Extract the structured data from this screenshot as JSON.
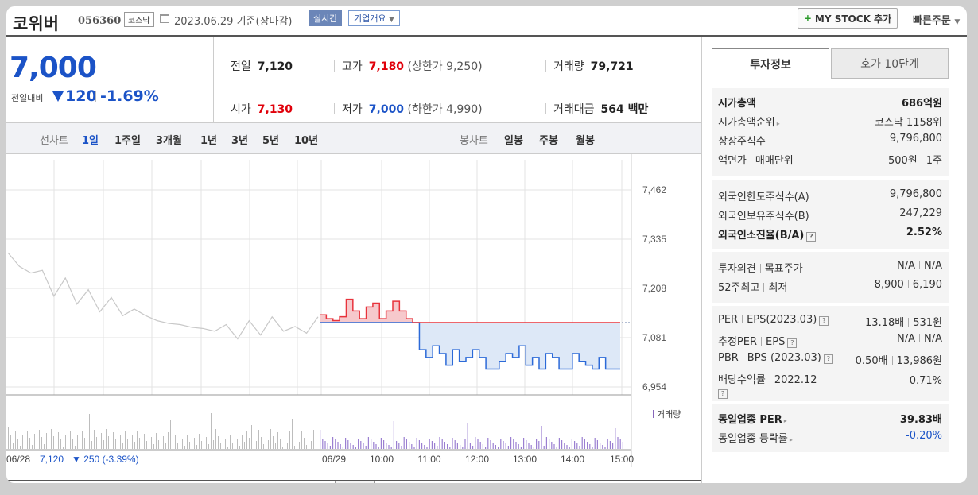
{
  "header": {
    "stock_name": "코위버",
    "stock_code": "056360",
    "market": "코스닥",
    "date": "2023.06.29  기준(장마감)",
    "realtime_label": "실시간",
    "company_overview": "기업개요",
    "mystock_label": "MY STOCK 추가",
    "quick_order": "빠른주문"
  },
  "quote": {
    "price": "7,000",
    "change_label": "전일대비",
    "change": "120",
    "change_pct": "-1.69%"
  },
  "stats": {
    "prev_label": "전일",
    "prev": "7,120",
    "high_label": "고가",
    "high": "7,180",
    "upper_limit": "(상한가 9,250)",
    "volume_label": "거래량",
    "volume": "79,721",
    "open_label": "시가",
    "open": "7,130",
    "low_label": "저가",
    "low": "7,000",
    "lower_limit": "(하한가 4,990)",
    "amount_label": "거래대금",
    "amount": "564 백만"
  },
  "toolbar": {
    "line_label": "선차트",
    "periods": [
      "1일",
      "1주일",
      "3개월",
      "1년",
      "3년",
      "5년",
      "10년"
    ],
    "candle_label": "봉차트",
    "candles": [
      "일봉",
      "주봉",
      "월봉"
    ]
  },
  "chart_data": {
    "type": "line",
    "y_ticks": [
      "7,462",
      "7,335",
      "7,208",
      "7,081",
      "6,954"
    ],
    "ylim": [
      6954,
      7462
    ],
    "x_labels": [
      "06/28",
      "06/29",
      "10:00",
      "11:00",
      "12:00",
      "13:00",
      "14:00",
      "15:00"
    ],
    "volume_label": "거래량",
    "prev_day_label": "06/28",
    "prev_day_close": "7,120",
    "prev_day_change": "▼ 250  (-3.39%)",
    "reference_price": 7120,
    "series": [
      {
        "values": [
          7140,
          7130,
          7125,
          7135,
          7180,
          7150,
          7130,
          7160,
          7170,
          7130,
          7150,
          7175,
          7150,
          7130,
          7120,
          7050,
          7030,
          7060,
          7040,
          7010,
          7050,
          7020,
          7030,
          7050,
          7030,
          7000,
          7000,
          7020,
          7040,
          7030,
          7060,
          7010,
          7030,
          7000,
          7040,
          7030,
          7000,
          7000,
          7040,
          7020,
          7010,
          7000,
          7030,
          7000,
          7000
        ]
      }
    ],
    "previous_day_values": [
      7300,
      7250,
      7260,
      7240,
      7200,
      7220,
      7180,
      7190,
      7160,
      7170,
      7150,
      7140,
      7150,
      7110,
      7130,
      7100,
      7120,
      7090,
      7110,
      7100,
      7090,
      7110,
      7100,
      7120,
      7110,
      7095,
      7105,
      7120
    ]
  },
  "info": {
    "tab_active": "투자정보",
    "tab_other": "호가 10단계",
    "market_cap_label": "시가총액",
    "market_cap": "686억원",
    "rank_label": "시가총액순위",
    "rank": "코스닥 1158위",
    "shares_label": "상장주식수",
    "shares": "9,796,800",
    "par_label": "액면가",
    "unit_label": "매매단위",
    "par": "500원",
    "unit": "1주",
    "foreign_limit_label": "외국인한도주식수(A)",
    "foreign_limit": "9,796,800",
    "foreign_hold_label": "외국인보유주식수(B)",
    "foreign_hold": "247,229",
    "foreign_ratio_label": "외국인소진율(B/A)",
    "foreign_ratio": "2.52%",
    "opinion_label": "투자의견",
    "target_label": "목표주가",
    "opinion": "N/A",
    "target": "N/A",
    "high52_label": "52주최고",
    "low52_label": "최저",
    "high52": "8,900",
    "low52": "6,190",
    "per_label": "PER",
    "eps_label": "EPS(2023.03)",
    "per": "13.18배",
    "eps": "531원",
    "est_per_label": "추정PER",
    "est_eps_label": "EPS",
    "est_per": "N/A",
    "est_eps": "N/A",
    "pbr_label": "PBR",
    "bps_label": "BPS (2023.03)",
    "pbr": "0.50배",
    "bps": "13,986원",
    "div_label": "배당수익률",
    "div_year": "2022.12",
    "div": "0.71%",
    "sector_per_label": "동일업종 PER",
    "sector_per": "39.83배",
    "sector_chg_label": "동일업종 등락률",
    "sector_chg": "-0.20%"
  }
}
